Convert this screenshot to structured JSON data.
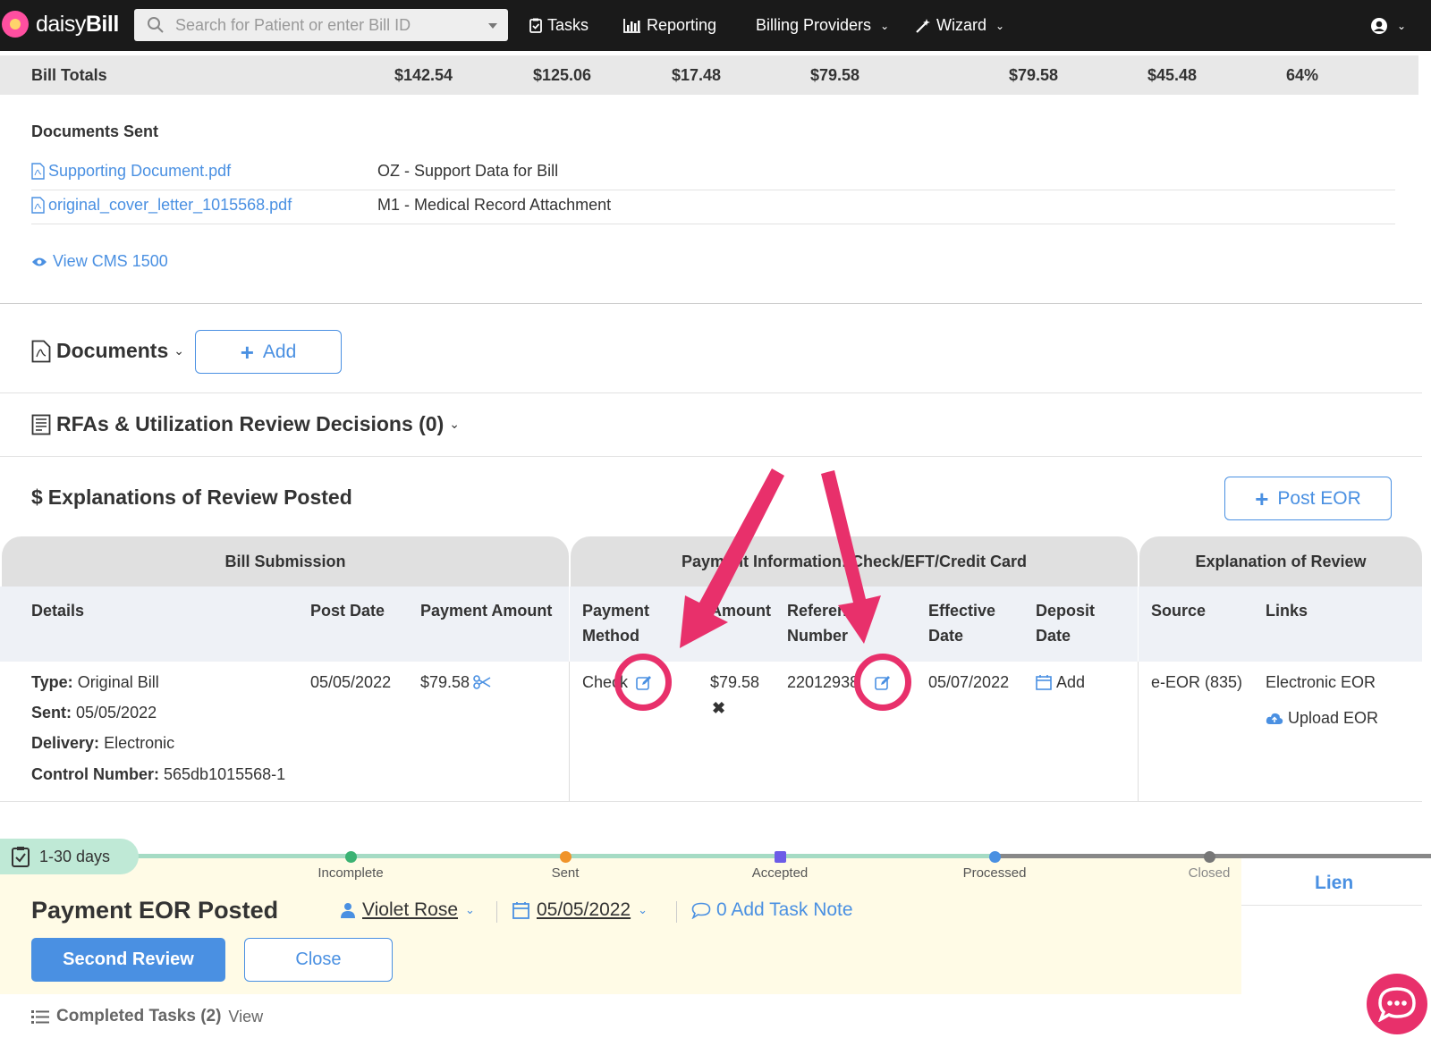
{
  "topbar": {
    "logo_prefix": "daisy",
    "logo_suffix": "Bill",
    "search_placeholder": "Search for Patient or enter Bill ID",
    "nav": {
      "tasks": "Tasks",
      "reporting": "Reporting",
      "billing_providers": "Billing Providers",
      "wizard": "Wizard"
    }
  },
  "bill_totals": {
    "label": "Bill Totals",
    "values": [
      "$142.54",
      "$125.06",
      "$17.48",
      "$79.58",
      "$79.58",
      "$45.48",
      "64%"
    ]
  },
  "documents_sent": {
    "title": "Documents Sent",
    "rows": [
      {
        "file": "Supporting Document.pdf",
        "desc": "OZ - Support Data for Bill"
      },
      {
        "file": "original_cover_letter_1015568.pdf",
        "desc": "M1 - Medical Record Attachment"
      }
    ],
    "view_link": "View CMS 1500"
  },
  "documents": {
    "title": "Documents",
    "add_label": "Add"
  },
  "rfas": {
    "title": "RFAs & Utilization Review Decisions (0)"
  },
  "eor": {
    "title": "Explanations of Review Posted",
    "post_button": "Post EOR",
    "groups": [
      "Bill Submission",
      "Payment Information: Check/EFT/Credit Card",
      "Explanation of Review"
    ],
    "columns": {
      "details": "Details",
      "post_date": "Post Date",
      "payment_amount": "Payment Amount",
      "payment_method": [
        "Payment",
        "Method"
      ],
      "amount": "Amount",
      "reference_number": [
        "Reference",
        "Number"
      ],
      "effective_date": [
        "Effective",
        "Date"
      ],
      "deposit_date": [
        "Deposit",
        "Date"
      ],
      "source": "Source",
      "links": "Links"
    },
    "row": {
      "type_label": "Type:",
      "type_value": "Original Bill",
      "sent_label": "Sent:",
      "sent_value": "05/05/2022",
      "delivery_label": "Delivery:",
      "delivery_value": "Electronic",
      "control_label": "Control Number:",
      "control_value": "565db1015568-1",
      "post_date": "05/05/2022",
      "payment_amount": "$79.58",
      "payment_method": "Check",
      "amount": "$79.58",
      "reference_number": "22012938",
      "effective_date": "05/07/2022",
      "deposit_add": "Add",
      "source": "e-EOR (835)",
      "link_electronic": "Electronic EOR",
      "link_upload": "Upload EOR"
    }
  },
  "task": {
    "age": "1-30 days",
    "stages": [
      "Incomplete",
      "Sent",
      "Accepted",
      "Processed",
      "Closed"
    ],
    "stage_colors": [
      "#3bb273",
      "#f0932b",
      "#6c5ce7",
      "#4a90e2",
      "#777777"
    ],
    "title": "Payment EOR Posted",
    "assignee": "Violet Rose",
    "date": "05/05/2022",
    "note": "0 Add Task Note",
    "primary_button": "Second Review",
    "close_button": "Close",
    "side_tab": "Lien",
    "completed_label": "Completed Tasks (2)",
    "completed_view": "View"
  },
  "colors": {
    "accent": "#4a90e2",
    "highlight": "#e8306b",
    "topbar": "#1a1a1a"
  }
}
